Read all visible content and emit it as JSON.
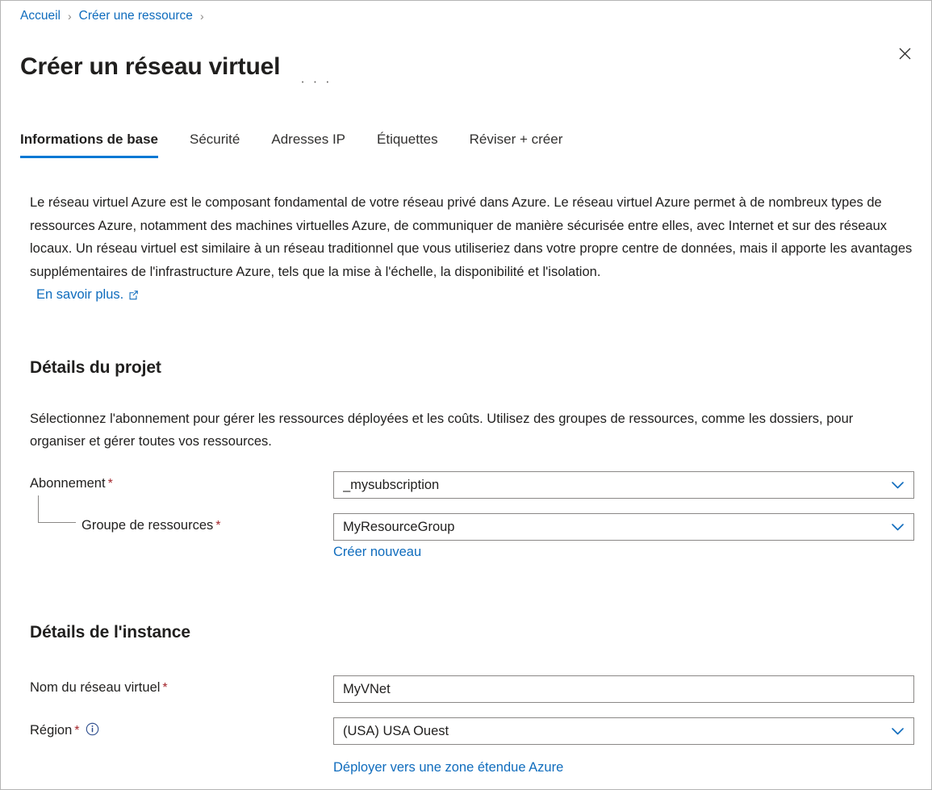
{
  "breadcrumb": {
    "items": [
      {
        "label": "Accueil"
      },
      {
        "label": "Créer une ressource"
      }
    ],
    "separator": "›"
  },
  "header": {
    "title": "Créer un réseau virtuel",
    "more_label": "• • •",
    "close_label": ""
  },
  "tabs": [
    {
      "label": "Informations de base",
      "active": true
    },
    {
      "label": "Sécurité",
      "active": false
    },
    {
      "label": "Adresses IP",
      "active": false
    },
    {
      "label": "Étiquettes",
      "active": false
    },
    {
      "label": "Réviser + créer",
      "active": false
    }
  ],
  "description": {
    "text": "Le réseau virtuel Azure est le composant fondamental de votre réseau privé dans Azure. Le réseau virtuel Azure permet à de nombreux types de ressources Azure, notamment des machines virtuelles Azure, de communiquer de manière sécurisée entre elles, avec Internet et sur des réseaux locaux. Un réseau virtuel est similaire à un réseau traditionnel que vous utiliseriez dans votre propre centre de données, mais il apporte les avantages supplémentaires de l'infrastructure Azure, tels que la mise à l'échelle, la disponibilité et l'isolation.",
    "learn_more": "En savoir plus."
  },
  "project_details": {
    "title": "Détails du projet",
    "description": "Sélectionnez l'abonnement pour gérer les ressources déployées et les coûts. Utilisez des groupes de ressources, comme les dossiers, pour organiser et gérer toutes vos ressources.",
    "subscription": {
      "label": "Abonnement",
      "required": "*",
      "value": "_mysubscription"
    },
    "resource_group": {
      "label": "Groupe de ressources",
      "required": "*",
      "value": "MyResourceGroup",
      "create_new": "Créer nouveau"
    }
  },
  "instance_details": {
    "title": "Détails de l'instance",
    "vnet_name": {
      "label": "Nom du réseau virtuel",
      "required": "*",
      "value": "MyVNet"
    },
    "region": {
      "label": "Région",
      "required": "*",
      "value": "(USA) USA Ouest",
      "deploy_link": "Déployer vers une zone étendue Azure"
    }
  },
  "colors": {
    "accent": "#0078d4",
    "link": "#0f6cbd",
    "required": "#a4262c",
    "text": "#201f1e",
    "border": "#8a8886"
  }
}
